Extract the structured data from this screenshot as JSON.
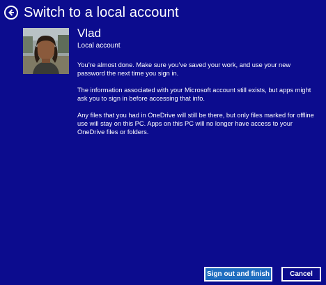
{
  "header": {
    "title": "Switch to a local account",
    "back_icon": "arrow-left-circle-icon"
  },
  "user": {
    "name": "Vlad",
    "account_type": "Local account"
  },
  "body": {
    "paragraphs": [
      "You’re almost done. Make sure you’ve saved your work, and use your new password the next time you sign in.",
      "The information associated with your Microsoft account still exists, but apps might ask you to sign in before accessing that info.",
      "Any files that you had in OneDrive will still be there, but only files marked for offline use will stay on this PC. Apps on this PC will no longer have access to your OneDrive files or folders."
    ]
  },
  "buttons": {
    "primary_label": "Sign out and finish",
    "cancel_label": "Cancel"
  },
  "colors": {
    "background": "#0c0c8e",
    "primary_button": "#1f6ec0",
    "text": "#ffffff"
  }
}
